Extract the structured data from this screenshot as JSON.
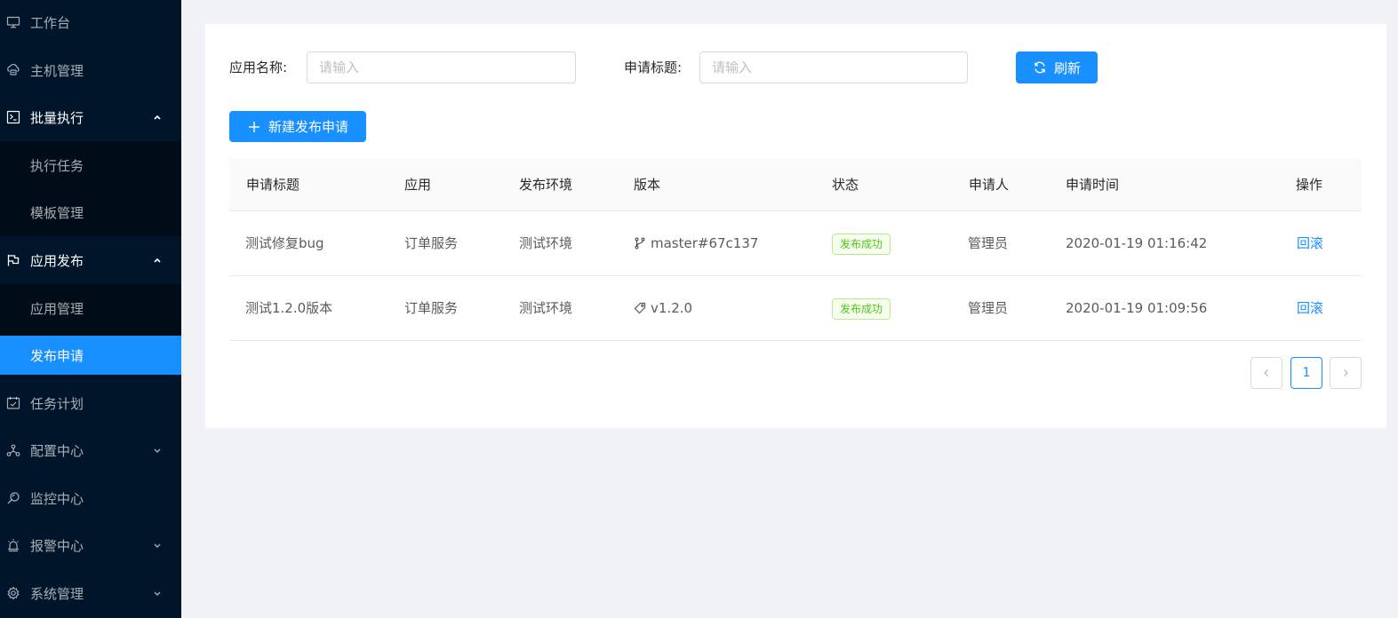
{
  "sidebar": {
    "items": [
      {
        "label": "工作台",
        "icon": "desktop-icon"
      },
      {
        "label": "主机管理",
        "icon": "cloud-server-icon"
      },
      {
        "label": "批量执行",
        "icon": "code-icon",
        "expanded": true
      },
      {
        "label": "执行任务"
      },
      {
        "label": "模板管理"
      },
      {
        "label": "应用发布",
        "icon": "flag-icon",
        "expanded": true
      },
      {
        "label": "应用管理"
      },
      {
        "label": "发布申请",
        "active": true
      },
      {
        "label": "任务计划",
        "icon": "schedule-icon"
      },
      {
        "label": "配置中心",
        "icon": "deployment-unit-icon"
      },
      {
        "label": "监控中心",
        "icon": "monitor-icon"
      },
      {
        "label": "报警中心",
        "icon": "alert-icon"
      },
      {
        "label": "系统管理",
        "icon": "setting-icon"
      }
    ]
  },
  "filters": {
    "app_name_label": "应用名称:",
    "app_name_placeholder": "请输入",
    "title_label": "申请标题:",
    "title_placeholder": "请输入",
    "refresh_label": "刷新"
  },
  "toolbar": {
    "new_request_label": "新建发布申请"
  },
  "table": {
    "columns": [
      "申请标题",
      "应用",
      "发布环境",
      "版本",
      "状态",
      "申请人",
      "申请时间",
      "操作"
    ],
    "rows": [
      {
        "title": "测试修复bug",
        "app": "订单服务",
        "env": "测试环境",
        "version": "master#67c137",
        "version_icon": "branch-icon",
        "status": "发布成功",
        "applicant": "管理员",
        "time": "2020-01-19 01:16:42",
        "action": "回滚"
      },
      {
        "title": "测试1.2.0版本",
        "app": "订单服务",
        "env": "测试环境",
        "version": "v1.2.0",
        "version_icon": "tag-icon",
        "status": "发布成功",
        "applicant": "管理员",
        "time": "2020-01-19 01:09:56",
        "action": "回滚"
      }
    ]
  },
  "pagination": {
    "current_page": "1"
  },
  "colors": {
    "sidebar_bg": "#001529",
    "submenu_bg": "#000c17",
    "primary": "#1890ff",
    "success": "#52c41a"
  }
}
